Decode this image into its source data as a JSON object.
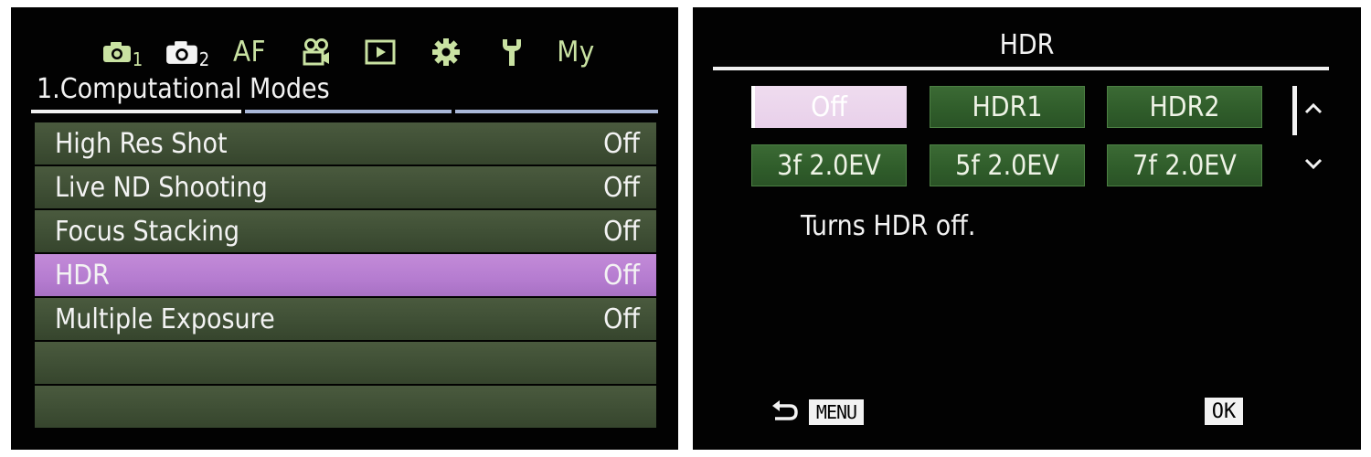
{
  "left": {
    "tabs": [
      {
        "icon": "camera-icon",
        "subscript": "1"
      },
      {
        "icon": "camera-icon",
        "subscript": "2",
        "active": true
      },
      {
        "label": "AF"
      },
      {
        "icon": "video-camera-icon"
      },
      {
        "icon": "playback-icon"
      },
      {
        "icon": "gear-icon"
      },
      {
        "icon": "wrench-icon"
      },
      {
        "label": "My"
      }
    ],
    "section_title": "1.Computational Modes",
    "items": [
      {
        "label": "High Res Shot",
        "value": "Off"
      },
      {
        "label": "Live ND Shooting",
        "value": "Off"
      },
      {
        "label": "Focus Stacking",
        "value": "Off"
      },
      {
        "label": "HDR",
        "value": "Off",
        "selected": true
      },
      {
        "label": "Multiple Exposure",
        "value": "Off"
      }
    ]
  },
  "right": {
    "title": "HDR",
    "options": [
      "Off",
      "HDR1",
      "HDR2",
      "3f 2.0EV",
      "5f 2.0EV",
      "7f 2.0EV"
    ],
    "selected": "Off",
    "description": "Turns HDR off.",
    "menu_key": "MENU",
    "ok_key": "OK"
  },
  "colors": {
    "menu_row": "#3f4f35",
    "menu_row_selected": "#b57cd0",
    "tab_text": "#c9e2a2",
    "option_green": "#2f5c2a"
  }
}
